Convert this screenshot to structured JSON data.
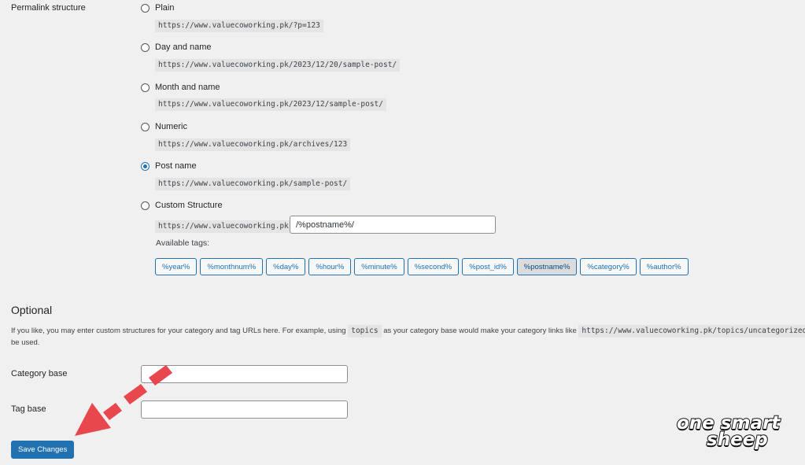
{
  "permalink": {
    "label": "Permalink structure",
    "options": [
      {
        "label": "Plain",
        "example": "https://www.valuecoworking.pk/?p=123",
        "checked": false
      },
      {
        "label": "Day and name",
        "example": "https://www.valuecoworking.pk/2023/12/20/sample-post/",
        "checked": false
      },
      {
        "label": "Month and name",
        "example": "https://www.valuecoworking.pk/2023/12/sample-post/",
        "checked": false
      },
      {
        "label": "Numeric",
        "example": "https://www.valuecoworking.pk/archives/123",
        "checked": false
      },
      {
        "label": "Post name",
        "example": "https://www.valuecoworking.pk/sample-post/",
        "checked": true
      },
      {
        "label": "Custom Structure",
        "example": "https://www.valuecoworking.pk",
        "checked": false
      }
    ],
    "custom_value": "/%postname%/",
    "available_tags_label": "Available tags:",
    "tags": [
      "%year%",
      "%monthnum%",
      "%day%",
      "%hour%",
      "%minute%",
      "%second%",
      "%post_id%",
      "%postname%",
      "%category%",
      "%author%"
    ],
    "active_tag": "%postname%"
  },
  "optional": {
    "title": "Optional",
    "desc_part1": "If you like, you may enter custom structures for your category and tag URLs here. For example, using",
    "desc_code1": "topics",
    "desc_part2": "as your category base would make your category links like",
    "desc_code2": "https://www.valuecoworking.pk/topics/uncategorized/",
    "desc_part3": "be used.",
    "category_base_label": "Category base",
    "category_base_value": "",
    "tag_base_label": "Tag base",
    "tag_base_value": ""
  },
  "save_button": "Save Changes",
  "logo": {
    "line1": "one smart",
    "line2": "sheep"
  },
  "colors": {
    "accent": "#2271b1",
    "arrow": "#e8474d",
    "background": "#f0f0f1"
  }
}
